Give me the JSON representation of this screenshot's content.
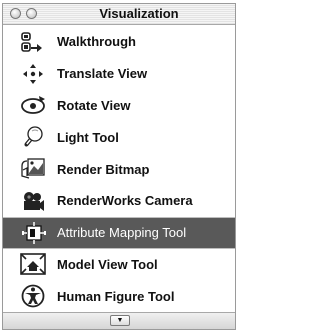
{
  "window": {
    "title": "Visualization"
  },
  "tools": [
    {
      "label": "Walkthrough",
      "icon": "walkthrough-icon"
    },
    {
      "label": "Translate View",
      "icon": "translate-view-icon"
    },
    {
      "label": "Rotate View",
      "icon": "rotate-view-icon"
    },
    {
      "label": "Light Tool",
      "icon": "light-bulb-icon"
    },
    {
      "label": "Render Bitmap",
      "icon": "render-bitmap-icon"
    },
    {
      "label": "RenderWorks Camera",
      "icon": "camera-icon"
    },
    {
      "label": "Attribute Mapping Tool",
      "icon": "attribute-mapping-icon",
      "selected": true
    },
    {
      "label": "Model View Tool",
      "icon": "model-view-icon"
    },
    {
      "label": "Human Figure Tool",
      "icon": "human-figure-icon"
    }
  ],
  "footer": {
    "expand_glyph": "▼"
  },
  "colors": {
    "selected_row": "#595959",
    "selected_text": "#ffffff"
  }
}
